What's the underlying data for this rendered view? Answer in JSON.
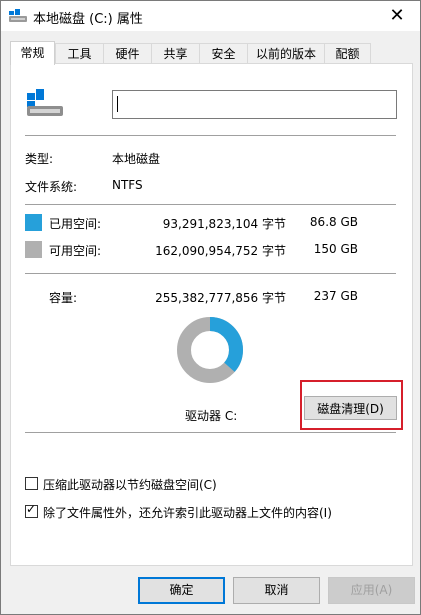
{
  "window": {
    "title": "本地磁盘 (C:) 属性",
    "close_glyph": "✕"
  },
  "tabs": [
    "常规",
    "工具",
    "硬件",
    "共享",
    "安全",
    "以前的版本",
    "配额"
  ],
  "general": {
    "name_value": "",
    "type_label": "类型:",
    "type_value": "本地磁盘",
    "fs_label": "文件系统:",
    "fs_value": "NTFS",
    "used": {
      "label": "已用空间:",
      "bytes": "93,291,823,104 字节",
      "size": "86.8 GB",
      "color": "#26a0da"
    },
    "free": {
      "label": "可用空间:",
      "bytes": "162,090,954,752 字节",
      "size": "150 GB",
      "color": "#b0b0b0"
    },
    "capacity": {
      "label": "容量:",
      "bytes": "255,382,777,856 字节",
      "size": "237 GB"
    },
    "used_fraction": 0.365,
    "drive_label": "驱动器 C:",
    "cleanup_button": "磁盘清理(D)",
    "compress_checkbox": {
      "label": "压缩此驱动器以节约磁盘空间(C)",
      "checked": false
    },
    "index_checkbox": {
      "label": "除了文件属性外，还允许索引此驱动器上文件的内容(I)",
      "checked": true,
      "check_glyph": "✓"
    }
  },
  "buttons": {
    "ok": "确定",
    "cancel": "取消",
    "apply": "应用(A)"
  }
}
